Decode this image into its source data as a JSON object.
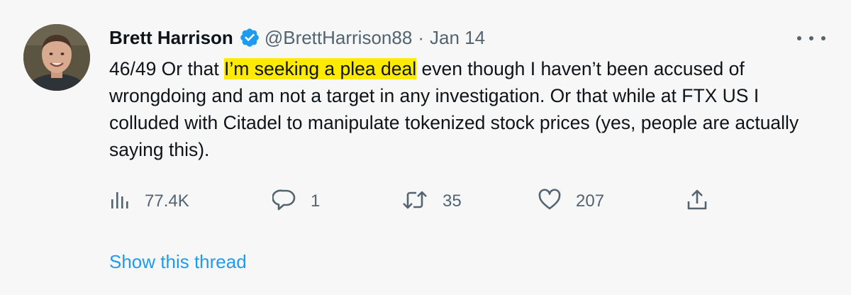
{
  "tweet": {
    "author_name": "Brett Harrison",
    "handle": "@BrettHarrison88",
    "separator": "·",
    "date": "Jan 14",
    "verified": true,
    "text_before_highlight": "46/49 Or that ",
    "text_highlight": "I’m seeking a plea deal",
    "text_after_highlight": " even though I haven’t been accused of wrongdoing and am not a target in any investigation. Or that while at FTX US I colluded with Citadel to manipulate tokenized stock prices (yes, people are actually saying this).",
    "highlight_color": "#ffeb00"
  },
  "actions": {
    "views": "77.4K",
    "replies": "1",
    "retweets": "35",
    "likes": "207"
  },
  "show_thread_label": "Show this thread",
  "colors": {
    "background": "#f7f7f7",
    "text": "#0f1419",
    "secondary_text": "#536471",
    "link": "#1d9bf0",
    "verified_badge": "#1d9bf0"
  },
  "icons": {
    "views": "bar-chart-icon",
    "replies": "speech-bubble-icon",
    "retweets": "retweet-arrows-icon",
    "likes": "heart-icon",
    "share": "share-upload-icon",
    "more": "more-dots-icon",
    "verified": "verified-badge-icon"
  }
}
